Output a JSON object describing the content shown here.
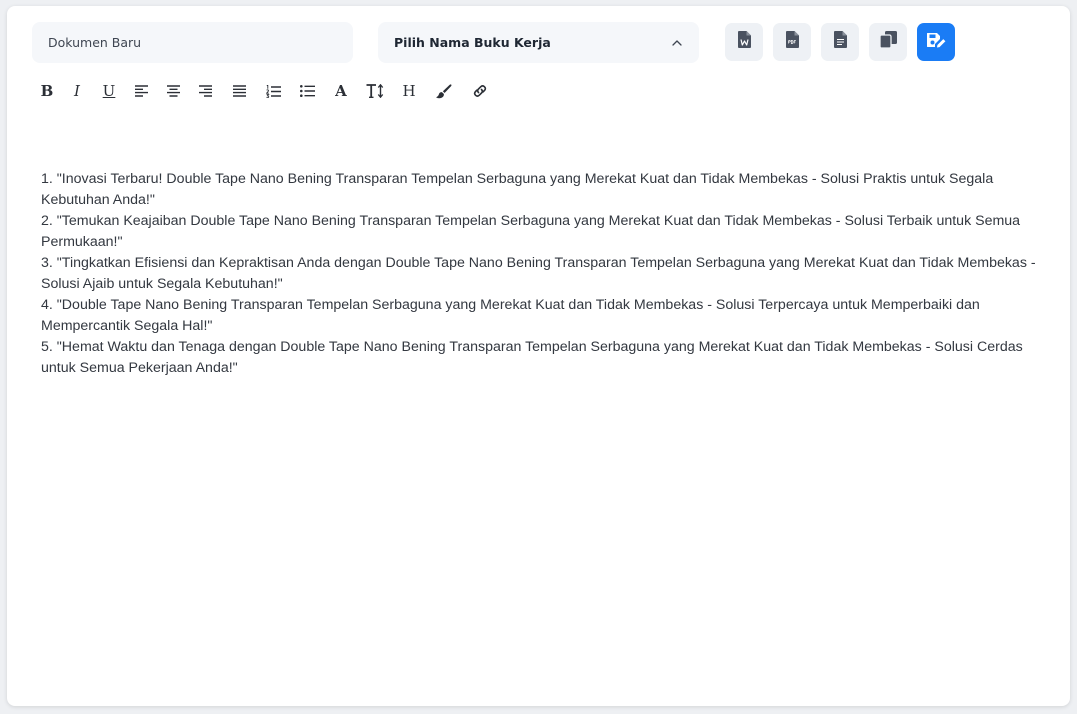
{
  "header": {
    "doc_name_placeholder": "Dokumen Baru",
    "workbook_select_label": "Pilih Nama Buku Kerja"
  },
  "actions": [
    {
      "name": "export-word",
      "icon": "word-file-icon",
      "active": false
    },
    {
      "name": "export-pdf",
      "icon": "pdf-file-icon",
      "active": false
    },
    {
      "name": "export-text",
      "icon": "document-icon",
      "active": false
    },
    {
      "name": "copy",
      "icon": "copy-icon",
      "active": false
    },
    {
      "name": "save",
      "icon": "save-edit-icon",
      "active": true
    }
  ],
  "toolbar": {
    "bold": "B",
    "italic": "I",
    "underline": "U",
    "font_color": "A",
    "heading": "H",
    "tools": [
      "bold-icon",
      "italic-icon",
      "underline-icon",
      "align-left-icon",
      "align-center-icon",
      "align-right-icon",
      "align-justify-icon",
      "ordered-list-icon",
      "bullet-list-icon",
      "font-color-icon",
      "font-size-icon",
      "heading-icon",
      "paint-brush-icon",
      "link-icon"
    ]
  },
  "editor": {
    "lines": [
      "1. \"Inovasi Terbaru! Double Tape Nano Bening Transparan Tempelan Serbaguna yang Merekat Kuat dan Tidak Membekas - Solusi Praktis untuk Segala Kebutuhan Anda!\"",
      "2. \"Temukan Keajaiban Double Tape Nano Bening Transparan Tempelan Serbaguna yang Merekat Kuat dan Tidak Membekas - Solusi Terbaik untuk Semua Permukaan!\"",
      "3. \"Tingkatkan Efisiensi dan Kepraktisan Anda dengan Double Tape Nano Bening Transparan Tempelan Serbaguna yang Merekat Kuat dan Tidak Membekas - Solusi Ajaib untuk Segala Kebutuhan!\"",
      "4. \"Double Tape Nano Bening Transparan Tempelan Serbaguna yang Merekat Kuat dan Tidak Membekas - Solusi Terpercaya untuk Memperbaiki dan Mempercantik Segala Hal!\"",
      "5. \"Hemat Waktu dan Tenaga dengan Double Tape Nano Bening Transparan Tempelan Serbaguna yang Merekat Kuat dan Tidak Membekas - Solusi Cerdas untuk Semua Pekerjaan Anda!\""
    ]
  },
  "colors": {
    "accent": "#1a7cf5",
    "field_bg": "#f5f7fa",
    "button_bg": "#eef1f5",
    "icon": "#4a5260",
    "text": "#333840"
  }
}
